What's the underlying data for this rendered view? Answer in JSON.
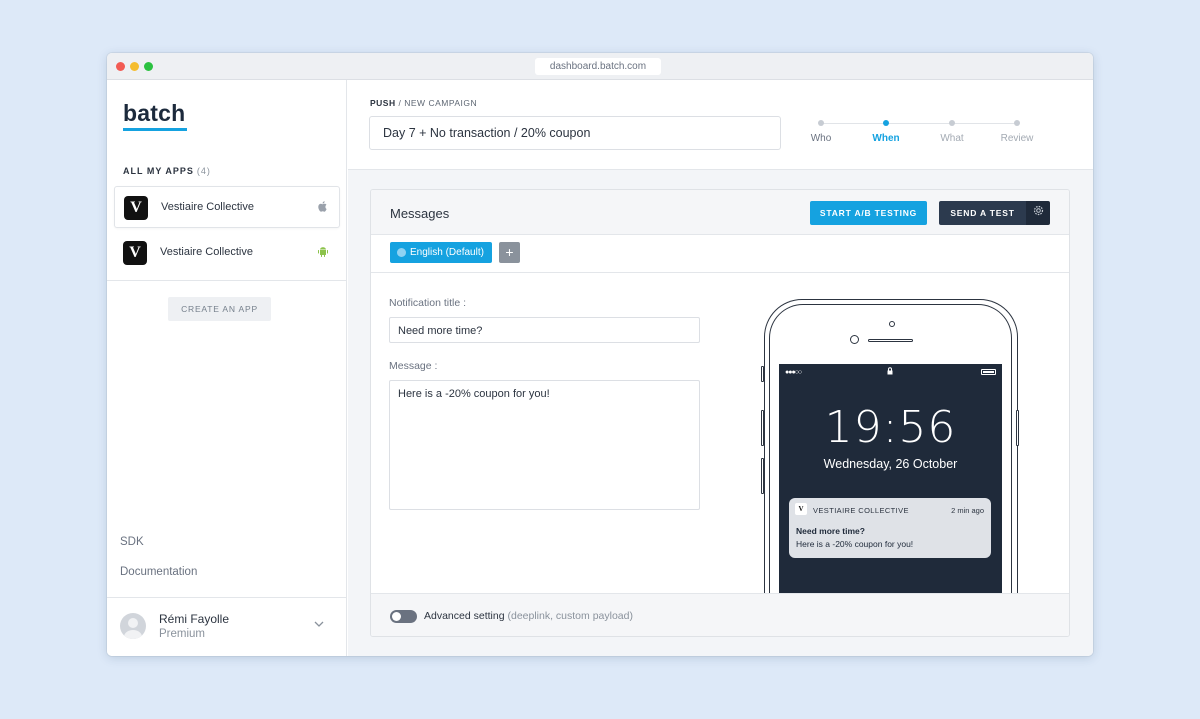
{
  "browser": {
    "url": "dashboard.batch.com"
  },
  "sidebar": {
    "logo": "batch",
    "apps_header": "ALL MY APPS",
    "apps_count": "(4)",
    "apps": [
      {
        "name": "Vestiaire Collective",
        "platform": "apple-icon",
        "icon_letter": "V"
      },
      {
        "name": "Vestiaire Collective",
        "platform": "android-icon",
        "icon_letter": "V"
      }
    ],
    "create_app": "CREATE AN APP",
    "links": [
      "SDK",
      "Documentation"
    ],
    "user": {
      "name": "Rémi Fayolle",
      "plan": "Premium"
    }
  },
  "header": {
    "breadcrumb_section": "PUSH",
    "breadcrumb_separator": "/",
    "breadcrumb_page": "NEW CAMPAIGN",
    "campaign_name": "Day 7 + No transaction / 20% coupon",
    "steps": [
      "Who",
      "When",
      "What",
      "Review"
    ],
    "active_step": "When"
  },
  "messages": {
    "title": "Messages",
    "ab_button": "START A/B TESTING",
    "test_button": "SEND A TEST",
    "language": "English (Default)",
    "add_language": "+",
    "notification_title_label": "Notification title :",
    "notification_title_value": "Need more time?",
    "message_label": "Message :",
    "message_value": "Here is a -20% coupon for you!",
    "advanced_label": "Advanced setting",
    "advanced_hint": "(deeplink, custom payload)"
  },
  "preview": {
    "time": "19:56",
    "date": "Wednesday, 26 October",
    "notif_app": "VESTIAIRE COLLECTIVE",
    "notif_time": "2 min ago",
    "notif_icon_letter": "V",
    "notif_title": "Need more time?",
    "notif_body": "Here is a -20% coupon for you!"
  },
  "colors": {
    "accent": "#15a2e0",
    "dark": "#2c3a4e",
    "screen": "#1f2a3a"
  }
}
